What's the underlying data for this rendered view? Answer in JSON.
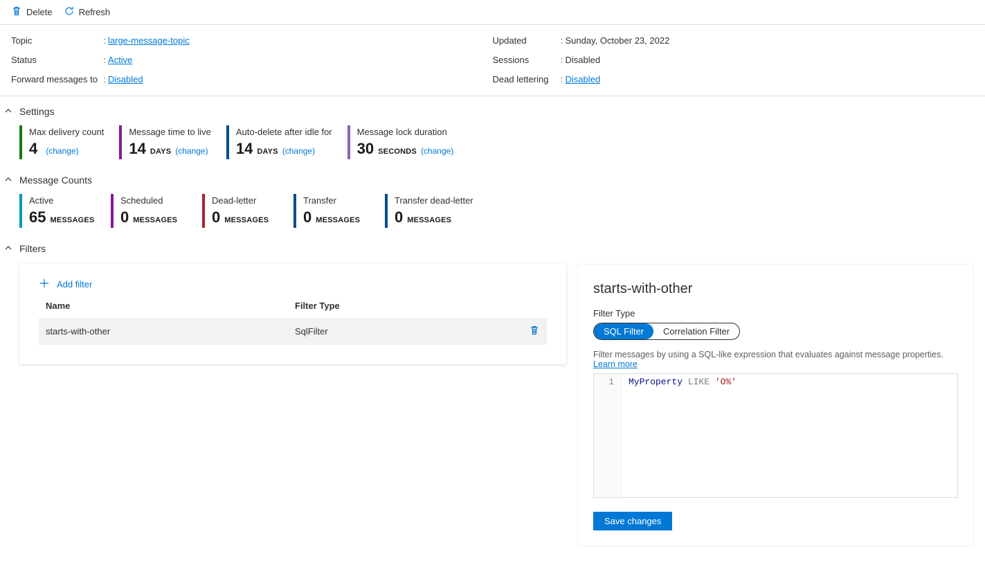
{
  "toolbar": {
    "delete_label": "Delete",
    "refresh_label": "Refresh"
  },
  "properties": {
    "left": {
      "topic": {
        "label": "Topic",
        "value": "large-message-topic"
      },
      "status": {
        "label": "Status",
        "value": "Active"
      },
      "forward": {
        "label": "Forward messages to",
        "value": "Disabled"
      }
    },
    "right": {
      "updated": {
        "label": "Updated",
        "value": "Sunday, October 23, 2022"
      },
      "sessions": {
        "label": "Sessions",
        "value": "Disabled"
      },
      "deadlettering": {
        "label": "Dead lettering",
        "value": "Disabled"
      }
    }
  },
  "sections": {
    "settings_title": "Settings",
    "message_counts_title": "Message Counts",
    "filters_title": "Filters"
  },
  "settings": {
    "change_label": "(change)",
    "max_delivery": {
      "caption": "Max delivery count",
      "value": "4",
      "unit": "",
      "color": "#107c10"
    },
    "ttl": {
      "caption": "Message time to live",
      "value": "14",
      "unit": "DAYS",
      "color": "#881798"
    },
    "auto_delete": {
      "caption": "Auto-delete after idle for",
      "value": "14",
      "unit": "DAYS",
      "color": "#004e8c"
    },
    "lock_duration": {
      "caption": "Message lock duration",
      "value": "30",
      "unit": "SECONDS",
      "color": "#8764b8"
    }
  },
  "counts": {
    "unit": "MESSAGES",
    "active": {
      "caption": "Active",
      "value": "65",
      "color": "#0099bc"
    },
    "scheduled": {
      "caption": "Scheduled",
      "value": "0",
      "color": "#881798"
    },
    "deadletter": {
      "caption": "Dead-letter",
      "value": "0",
      "color": "#a4262c"
    },
    "transfer": {
      "caption": "Transfer",
      "value": "0",
      "color": "#004e8c"
    },
    "transfer_dl": {
      "caption": "Transfer dead-letter",
      "value": "0",
      "color": "#004e8c"
    }
  },
  "filters_panel": {
    "add_filter_label": "Add filter",
    "headers": {
      "name": "Name",
      "type": "Filter Type"
    },
    "rows": [
      {
        "name": "starts-with-other",
        "type": "SqlFilter"
      }
    ]
  },
  "editor": {
    "title": "starts-with-other",
    "filter_type_label": "Filter Type",
    "options": {
      "sql": "SQL Filter",
      "correlation": "Correlation Filter"
    },
    "description": "Filter messages by using a SQL-like expression that evaluates against message properties.",
    "learn_more": "Learn more",
    "line_number": "1",
    "expr": {
      "ident": "MyProperty",
      "kw": "LIKE",
      "str": "'O%'"
    },
    "save_label": "Save changes"
  }
}
